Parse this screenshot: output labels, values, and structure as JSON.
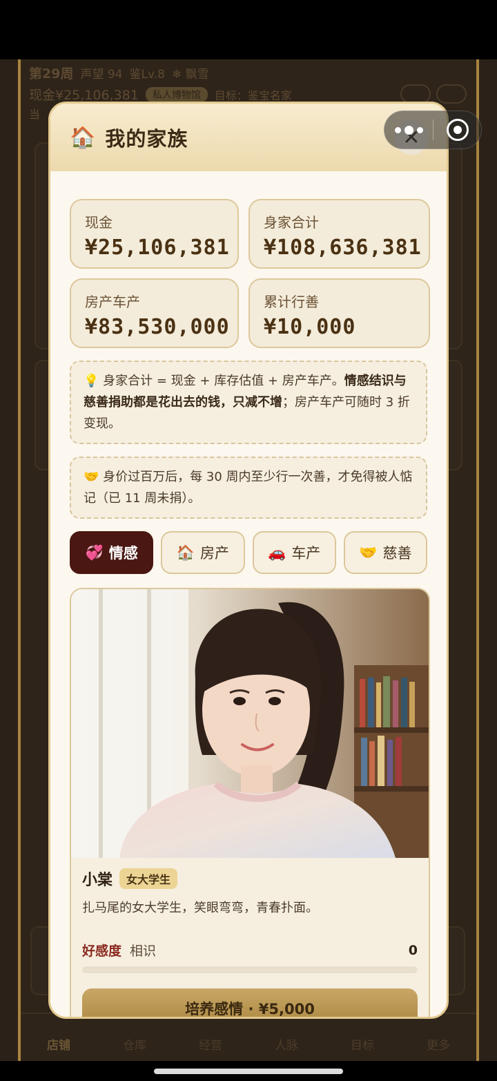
{
  "background": {
    "week": "第29周",
    "reputation": "声望 94",
    "level": "鉴Lv.8",
    "weather": "❄ 飘雪",
    "cash_line": "现金¥25,106,381",
    "shop_chip": "私人博物馆",
    "goal": "目标：鉴宝名家",
    "row3": "当",
    "nav": [
      "店铺",
      "仓库",
      "经营",
      "人脉",
      "目标",
      "更多"
    ]
  },
  "capsule": {
    "more_icon": "more-dots-icon",
    "close_icon": "target-close-icon"
  },
  "modal": {
    "title_icon": "🏠",
    "title": "我的家族",
    "close_glyph": "✕",
    "stats": [
      {
        "label": "现金",
        "value": "¥25,106,381"
      },
      {
        "label": "身家合计",
        "value": "¥108,636,381"
      },
      {
        "label": "房产车产",
        "value": "¥83,530,000"
      },
      {
        "label": "累计行善",
        "value": "¥10,000"
      }
    ],
    "note1": {
      "icon": "💡",
      "part1": "身家合计 = 现金 + 库存估值 + 房产车产。",
      "bold": "情感结识与慈善捐助都是花出去的钱，只减不增",
      "part2": "；房产车产可随时 3 折变现。"
    },
    "note2": {
      "icon": "🤝",
      "text": "身价过百万后，每 30 周内至少行一次善，才免得被人惦记（已 11 周未捐）。"
    },
    "tabs": [
      {
        "icon": "💞",
        "label": "情感",
        "active": true
      },
      {
        "icon": "🏠",
        "label": "房产",
        "active": false
      },
      {
        "icon": "🚗",
        "label": "车产",
        "active": false
      },
      {
        "icon": "🤝",
        "label": "慈善",
        "active": false
      }
    ],
    "person": {
      "name": "小棠",
      "tag": "女大学生",
      "desc": "扎马尾的女大学生，笑眼弯弯，青春扑面。",
      "favor_label": "好感度",
      "favor_level": "相识",
      "favor_value": "0",
      "favor_progress": 0.0,
      "cta": "培养感情 · ¥5,000"
    }
  }
}
